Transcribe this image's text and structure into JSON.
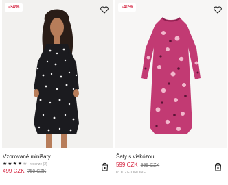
{
  "products": [
    {
      "discount": "-34%",
      "name": "Vzorované minišaty",
      "rating_stars": 4,
      "rating_max": 5,
      "reviews": "recenze (2)",
      "price": "499 CZK",
      "old_price": "759 CZK",
      "favorite_icon": "heart-outline-icon",
      "cart_icon": "shopping-bag-plus-icon"
    },
    {
      "discount": "-40%",
      "name": "Šaty s viskózou",
      "price": "599 CZK",
      "old_price": "999 CZK",
      "availability": "POUZE ONLINE",
      "favorite_icon": "heart-outline-icon",
      "cart_icon": "shopping-bag-plus-icon"
    }
  ],
  "colors": {
    "sale": "#d4213d",
    "text": "#1a1a1a",
    "muted": "#9a9a9a"
  }
}
